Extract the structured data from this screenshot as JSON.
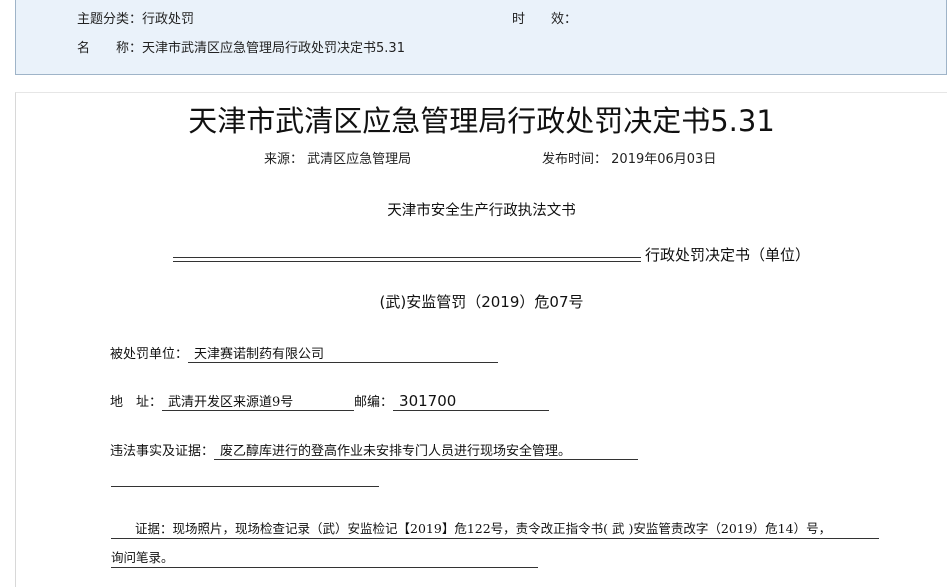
{
  "infobar": {
    "category_label": "主题分类：",
    "category_value": "行政处罚",
    "validity_label": "时　　效：",
    "validity_value": "",
    "name_label": "名　　称：",
    "name_value": "天津市武清区应急管理局行政处罚决定书5.31"
  },
  "document": {
    "title": "天津市武清区应急管理局行政处罚决定书5.31",
    "source_label": "来源：",
    "source_value": "武清区应急管理局",
    "published_label": "发布时间：",
    "published_value": "2019年06月03日",
    "subheading": "天津市安全生产行政执法文书",
    "decision_label": "行政处罚决定书（单位）",
    "doc_number": "(武)安监管罚（2019）危07号",
    "penalized_label": "被处罚单位：",
    "penalized_value": "天津赛诺制药有限公司",
    "address_label": "地　址：",
    "address_value": "武清开发区来源道9号",
    "postcode_label": "邮编：",
    "postcode_value": "301700",
    "facts_label": "违法事实及证据：",
    "facts_value": "废乙醇库进行的登高作业未安排专门人员进行现场安全管理。",
    "evidence_line1": "证据：现场照片，现场检查记录（武）安监检记【2019】危122号，责令改正指令书(  武  )安监管责改字（2019）危14）号，",
    "evidence_line2": "询问笔录。"
  }
}
